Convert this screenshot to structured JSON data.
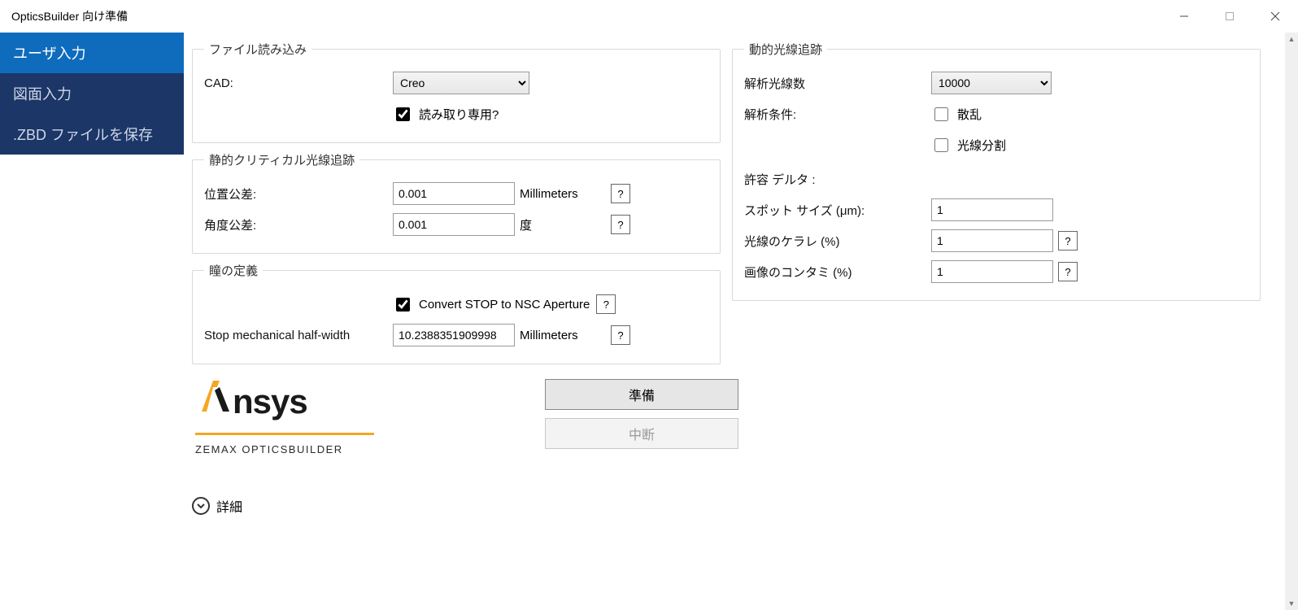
{
  "window": {
    "title": "OpticsBuilder 向け準備"
  },
  "sidebar": {
    "items": [
      {
        "label": "ユーザ入力"
      },
      {
        "label": "図面入力"
      },
      {
        "label": ".ZBD ファイルを保存"
      }
    ]
  },
  "file_load": {
    "legend": "ファイル読み込み",
    "cad_label": "CAD:",
    "cad_value": "Creo",
    "readonly_label": "読み取り専用?",
    "readonly_checked": true
  },
  "static_trace": {
    "legend": "静的クリティカル光線追跡",
    "pos_tol_label": "位置公差:",
    "pos_tol_value": "0.001",
    "pos_tol_unit": "Millimeters",
    "ang_tol_label": "角度公差:",
    "ang_tol_value": "0.001",
    "ang_tol_unit": "度"
  },
  "pupil": {
    "legend": "瞳の定義",
    "convert_label": "Convert STOP to NSC Aperture",
    "convert_checked": true,
    "stop_hw_label": "Stop mechanical half-width",
    "stop_hw_value": "10.2388351909998",
    "stop_hw_unit": "Millimeters"
  },
  "dynamic_trace": {
    "legend": "動的光線追跡",
    "ray_count_label": "解析光線数",
    "ray_count_value": "10000",
    "cond_label": "解析条件:",
    "scatter_label": "散乱",
    "scatter_checked": false,
    "split_label": "光線分割",
    "split_checked": false,
    "delta_label": "許容 デルタ :",
    "spot_label": "スポット サイズ (μm):",
    "spot_value": "1",
    "vignette_label": "光線のケラレ (%)",
    "vignette_value": "1",
    "contam_label": "画像のコンタミ (%)",
    "contam_value": "1"
  },
  "logo": {
    "brand": "Ansys",
    "sub": "ZEMAX OPTICSBUILDER"
  },
  "actions": {
    "prepare": "準備",
    "abort": "中断"
  },
  "details": {
    "label": "詳細"
  },
  "help": "?"
}
